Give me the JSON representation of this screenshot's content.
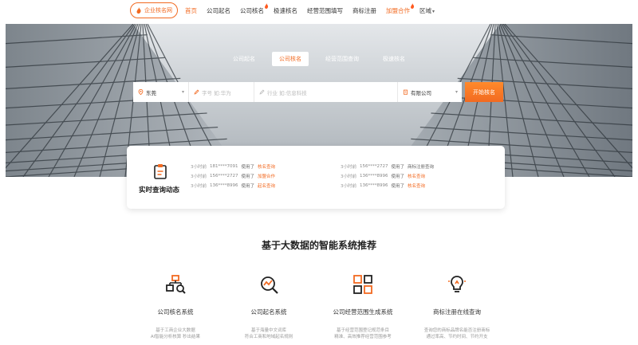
{
  "nav": {
    "brand": "企业核名网",
    "items": [
      {
        "label": "首页",
        "state": "active"
      },
      {
        "label": "公司起名",
        "state": "normal"
      },
      {
        "label": "公司核名",
        "state": "hot"
      },
      {
        "label": "极速核名",
        "state": "normal"
      },
      {
        "label": "经营范围填写",
        "state": "normal"
      },
      {
        "label": "商标注册",
        "state": "normal"
      },
      {
        "label": "加盟合作",
        "state": "promo"
      },
      {
        "label": "区域",
        "state": "dropdown"
      }
    ]
  },
  "hero": {
    "tabs": [
      "公司起名",
      "公司核名",
      "经营范围查询",
      "极速核名"
    ],
    "active_tab": 1,
    "search": {
      "city": "东莞",
      "name_placeholder": "字号 如:华为",
      "industry_placeholder": "行业 如:信息科技",
      "company_type": "有限公司",
      "button": "开始核名"
    }
  },
  "realtime": {
    "title": "实时查询动态",
    "left": [
      {
        "time": "3小时前",
        "phone": "181****7091",
        "used": "使用了",
        "service": "核名查询",
        "hl": true
      },
      {
        "time": "3小时前",
        "phone": "156****2727",
        "used": "使用了",
        "service": "加盟合作",
        "hl": true
      },
      {
        "time": "3小时前",
        "phone": "136****8996",
        "used": "使用了",
        "service": "起名查询",
        "hl": true
      }
    ],
    "right": [
      {
        "time": "3小时前",
        "phone": "156****2727",
        "used": "使用了",
        "service": "商标注册查询",
        "hl": false
      },
      {
        "time": "3小时前",
        "phone": "136****8996",
        "used": "使用了",
        "service": "核名查询",
        "hl": true
      },
      {
        "time": "3小时前",
        "phone": "136****8996",
        "used": "使用了",
        "service": "核名查询",
        "hl": true
      }
    ]
  },
  "section": {
    "title": "基于大数据的智能系统推荐",
    "features": [
      {
        "name": "公司核名系统",
        "icon": "org-search-icon",
        "desc1": "基于工商企业大数据",
        "desc2": "AI智能分析核算 秒出结果"
      },
      {
        "name": "公司起名系统",
        "icon": "magnifier-chart-icon",
        "desc1": "基于海量中文词库",
        "desc2": "符合工商和地域起名规则"
      },
      {
        "name": "公司经营范围生成系统",
        "icon": "grid-arrow-icon",
        "desc1": "基于经营范围登记规范条目",
        "desc2": "精准、高效推荐经营范围参考"
      },
      {
        "name": "商标注册在线查询",
        "icon": "bulb-icon",
        "desc1": "查询您的商标品牌名能否注册商标",
        "desc2": "通过率高、节约时间、节约开支"
      }
    ]
  },
  "colors": {
    "accent": "#f26a21",
    "text": "#333333"
  }
}
